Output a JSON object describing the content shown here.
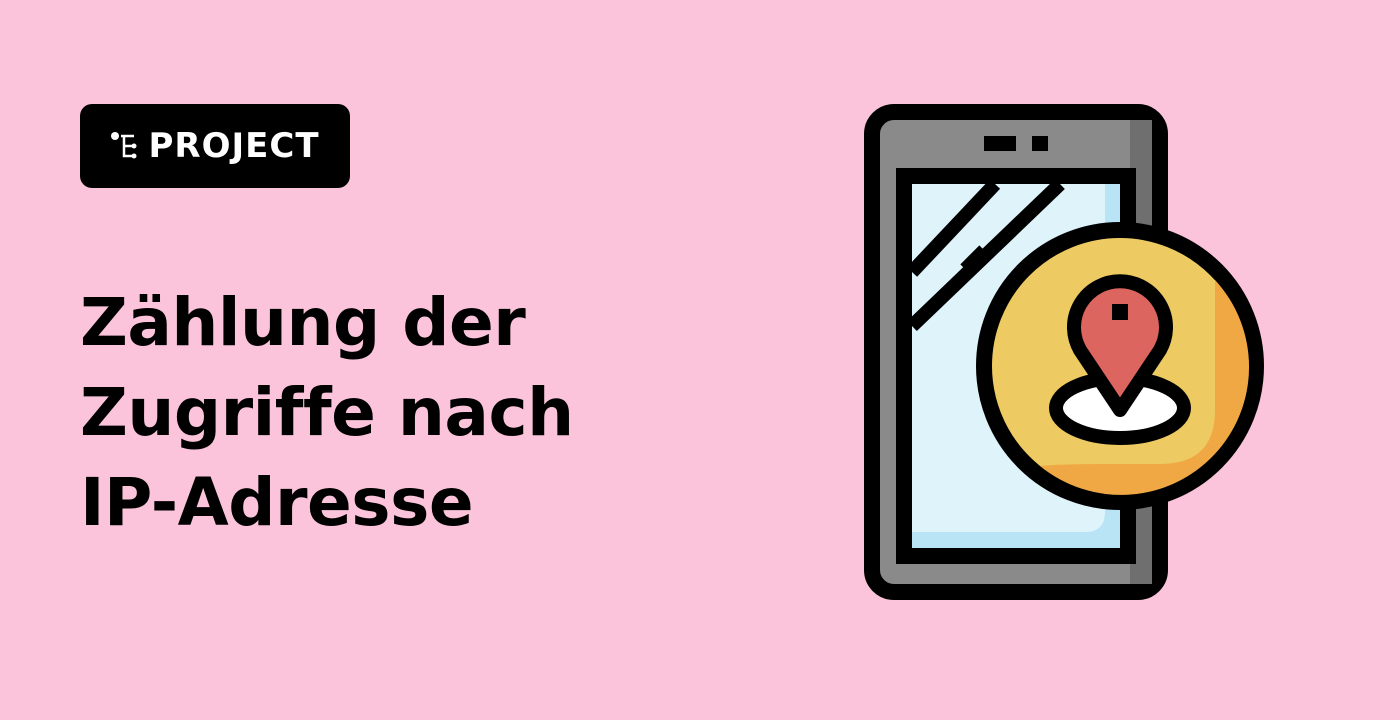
{
  "badge": {
    "label": "PROJECT",
    "icon": "tree-structure-icon"
  },
  "title": {
    "lines": [
      "Zählung der",
      "Zugriffe nach",
      "IP-Adresse"
    ]
  },
  "illustration": {
    "icon": "phone-location-pin-icon",
    "colors": {
      "background": "#fbc4db",
      "phone": "#8a8a8a",
      "screen": "#dff3fb",
      "circle": "#eecb62",
      "circle_shadow": "#f0a845",
      "pin": "#dd6560"
    }
  }
}
